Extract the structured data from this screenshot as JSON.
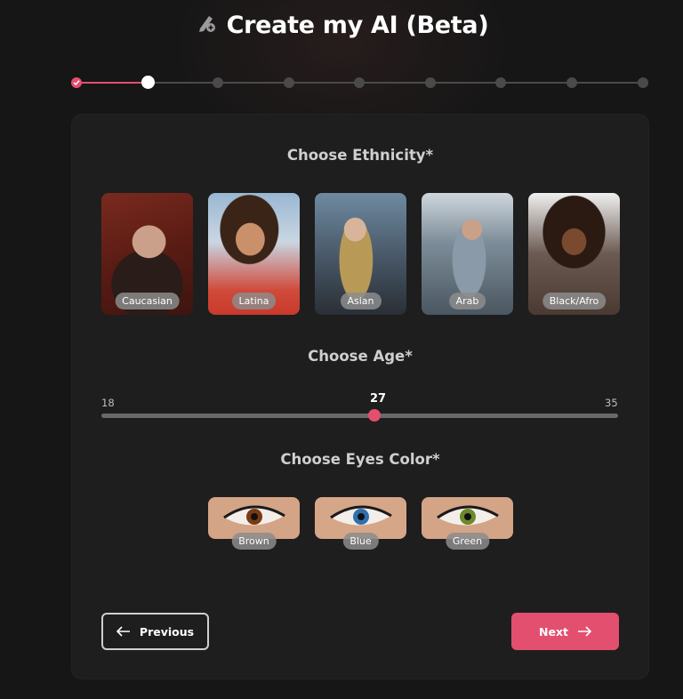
{
  "header": {
    "title": "Create my AI (Beta)",
    "icon": "pen-plus-icon"
  },
  "stepper": {
    "total_steps": 9,
    "current_step": 2,
    "completed_steps": 1,
    "accent": "#e34f6e"
  },
  "ethnicity": {
    "title": "Choose Ethnicity*",
    "options": [
      {
        "label": "Caucasian"
      },
      {
        "label": "Latina"
      },
      {
        "label": "Asian"
      },
      {
        "label": "Arab"
      },
      {
        "label": "Black/Afro"
      }
    ]
  },
  "age": {
    "title": "Choose Age*",
    "min": "18",
    "max": "35",
    "value": "27"
  },
  "eyes": {
    "title": "Choose Eyes Color*",
    "options": [
      {
        "label": "Brown",
        "iris": "#7a3b12"
      },
      {
        "label": "Blue",
        "iris": "#2f6fb0"
      },
      {
        "label": "Green",
        "iris": "#6b8a2a"
      }
    ]
  },
  "nav": {
    "previous_label": "Previous",
    "next_label": "Next"
  }
}
